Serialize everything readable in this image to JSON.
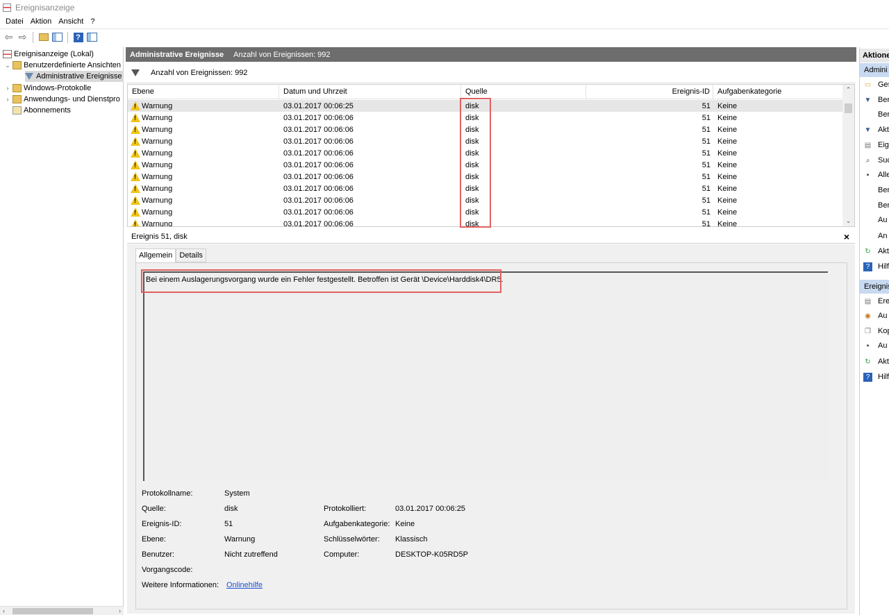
{
  "window": {
    "title": "Ereignisanzeige"
  },
  "menu": [
    "Datei",
    "Aktion",
    "Ansicht",
    "?"
  ],
  "tree": {
    "root": "Ereignisanzeige (Lokal)",
    "custom_views": "Benutzerdefinierte Ansichten",
    "admin_events": "Administrative Ereignisse",
    "windows_logs": "Windows-Protokolle",
    "app_logs": "Anwendungs- und Dienstpro",
    "subscriptions": "Abonnements"
  },
  "center": {
    "header_title": "Administrative Ereignisse",
    "header_count": "Anzahl von Ereignissen: 992",
    "filter_text": "Anzahl von Ereignissen: 992",
    "columns": [
      "Ebene",
      "Datum und Uhrzeit",
      "Quelle",
      "Ereignis-ID",
      "Aufgabenkategorie"
    ],
    "rows": [
      {
        "level": "Warnung",
        "date": "03.01.2017 00:06:25",
        "source": "disk",
        "id": "51",
        "category": "Keine"
      },
      {
        "level": "Warnung",
        "date": "03.01.2017 00:06:06",
        "source": "disk",
        "id": "51",
        "category": "Keine"
      },
      {
        "level": "Warnung",
        "date": "03.01.2017 00:06:06",
        "source": "disk",
        "id": "51",
        "category": "Keine"
      },
      {
        "level": "Warnung",
        "date": "03.01.2017 00:06:06",
        "source": "disk",
        "id": "51",
        "category": "Keine"
      },
      {
        "level": "Warnung",
        "date": "03.01.2017 00:06:06",
        "source": "disk",
        "id": "51",
        "category": "Keine"
      },
      {
        "level": "Warnung",
        "date": "03.01.2017 00:06:06",
        "source": "disk",
        "id": "51",
        "category": "Keine"
      },
      {
        "level": "Warnung",
        "date": "03.01.2017 00:06:06",
        "source": "disk",
        "id": "51",
        "category": "Keine"
      },
      {
        "level": "Warnung",
        "date": "03.01.2017 00:06:06",
        "source": "disk",
        "id": "51",
        "category": "Keine"
      },
      {
        "level": "Warnung",
        "date": "03.01.2017 00:06:06",
        "source": "disk",
        "id": "51",
        "category": "Keine"
      },
      {
        "level": "Warnung",
        "date": "03.01.2017 00:06:06",
        "source": "disk",
        "id": "51",
        "category": "Keine"
      },
      {
        "level": "Warnung",
        "date": "03.01.2017 00:06:06",
        "source": "disk",
        "id": "51",
        "category": "Keine"
      }
    ]
  },
  "detail": {
    "title": "Ereignis 51, disk",
    "close": "×",
    "tabs": [
      "Allgemein",
      "Details"
    ],
    "description": "Bei einem Auslagerungsvorgang wurde ein Fehler festgestellt. Betroffen ist Gerät \\Device\\Harddisk4\\DR5.",
    "labels": {
      "log_name": "Protokollname:",
      "source": "Quelle:",
      "event_id": "Ereignis-ID:",
      "level": "Ebene:",
      "user": "Benutzer:",
      "opcode": "Vorgangscode:",
      "more_info": "Weitere Informationen:",
      "logged": "Protokolliert:",
      "task_category": "Aufgabenkategorie:",
      "keywords": "Schlüsselwörter:",
      "computer": "Computer:"
    },
    "values": {
      "log_name": "System",
      "source": "disk",
      "event_id": "51",
      "level": "Warnung",
      "user": "Nicht zutreffend",
      "opcode": "",
      "more_info": "Onlinehilfe",
      "logged": "03.01.2017 00:06:25",
      "task_category": "Keine",
      "keywords": "Klassisch",
      "computer": "DESKTOP-K05RD5P"
    }
  },
  "actions": {
    "title": "Aktione",
    "section1": "Admini",
    "items1": [
      "Ges",
      "Ber",
      "Ber",
      "Akt",
      "Eig",
      "Suc",
      "Alle",
      "Ber",
      "Ber",
      "Au",
      "An",
      "Akt",
      "Hilf"
    ],
    "section2": "Ereignis",
    "items2": [
      "Ere",
      "Au",
      "Kop",
      "Au",
      "Akt",
      "Hilf"
    ]
  },
  "colors": {
    "header_bg": "#6d6d6d",
    "warning": "#f0c419",
    "highlight_box": "#e06060",
    "link": "#1a4fd6",
    "section_bg": "#c8daf0"
  }
}
